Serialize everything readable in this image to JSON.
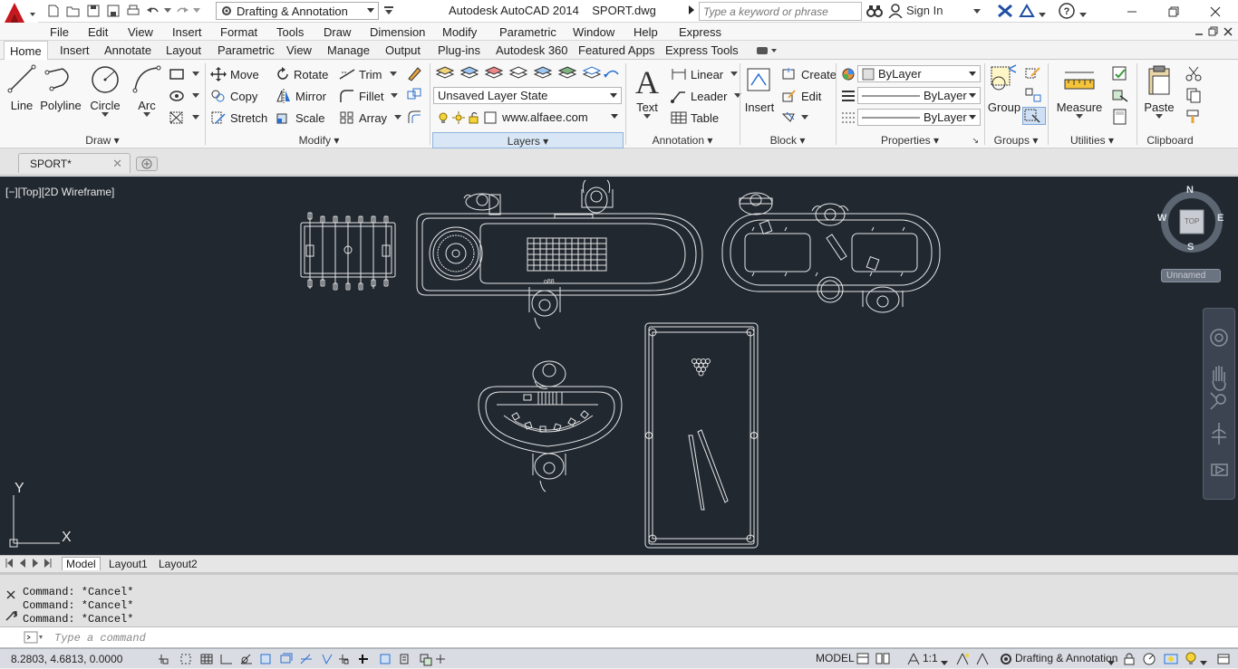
{
  "titlebar": {
    "workspace": "Drafting & Annotation",
    "title": "Autodesk AutoCAD 2014    SPORT.dwg",
    "search_placeholder": "Type a keyword or phrase",
    "sign_in": "Sign In"
  },
  "menu": [
    "File",
    "Edit",
    "View",
    "Insert",
    "Format",
    "Tools",
    "Draw",
    "Dimension",
    "Modify",
    "Parametric",
    "Window",
    "Help",
    "Express"
  ],
  "ribbon_tabs": [
    "Home",
    "Insert",
    "Annotate",
    "Layout",
    "Parametric",
    "View",
    "Manage",
    "Output",
    "Plug-ins",
    "Autodesk 360",
    "Featured Apps",
    "Express Tools"
  ],
  "draw": {
    "line": "Line",
    "polyline": "Polyline",
    "circle": "Circle",
    "arc": "Arc",
    "title": "Draw"
  },
  "modify": {
    "move": "Move",
    "rotate": "Rotate",
    "trim": "Trim",
    "copy": "Copy",
    "mirror": "Mirror",
    "fillet": "Fillet",
    "stretch": "Stretch",
    "scale": "Scale",
    "array": "Array",
    "title": "Modify"
  },
  "layers": {
    "state": "Unsaved Layer State",
    "current": "www.alfaee.com",
    "title": "Layers"
  },
  "annotation": {
    "text": "Text",
    "linear": "Linear",
    "leader": "Leader",
    "table": "Table",
    "title": "Annotation"
  },
  "block": {
    "insert": "Insert",
    "create": "Create",
    "edit": "Edit",
    "title": "Block"
  },
  "properties": {
    "color": "ByLayer",
    "linetype": "ByLayer",
    "lineweight": "ByLayer",
    "title": "Properties"
  },
  "groups": {
    "group": "Group",
    "title": "Groups"
  },
  "utilities": {
    "measure": "Measure",
    "title": "Utilities"
  },
  "clipboard": {
    "paste": "Paste",
    "title": "Clipboard"
  },
  "doc_tab": "SPORT*",
  "viewport_label": "[−][Top][2D Wireframe]",
  "viewcube": {
    "n": "N",
    "s": "S",
    "e": "E",
    "w": "W",
    "top": "TOP",
    "ucs": "Unnamed"
  },
  "ucs_axes": {
    "x": "X",
    "y": "Y"
  },
  "layout_tabs": [
    "Model",
    "Layout1",
    "Layout2"
  ],
  "command_history": [
    "Command: *Cancel*",
    "Command: *Cancel*",
    "Command: *Cancel*"
  ],
  "command_placeholder": "Type a command",
  "status": {
    "coords": "8.2803, 4.6813, 0.0000",
    "model": "MODEL",
    "scale": "1:1",
    "workspace": "Drafting & Annotation"
  },
  "colors": {
    "canvas": "#212830",
    "drawing": "#ffffff",
    "accent": "#cc1a1a"
  }
}
